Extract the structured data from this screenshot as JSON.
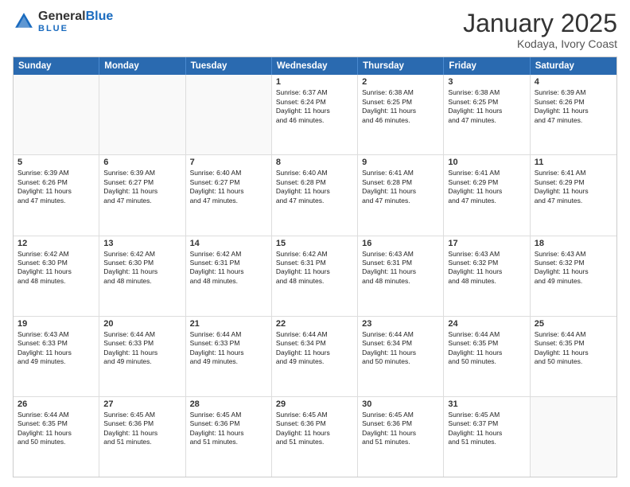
{
  "header": {
    "logo_general": "General",
    "logo_blue": "Blue",
    "month_title": "January 2025",
    "subtitle": "Kodaya, Ivory Coast"
  },
  "days_of_week": [
    "Sunday",
    "Monday",
    "Tuesday",
    "Wednesday",
    "Thursday",
    "Friday",
    "Saturday"
  ],
  "weeks": [
    [
      {
        "day": "",
        "text": "",
        "empty": true
      },
      {
        "day": "",
        "text": "",
        "empty": true
      },
      {
        "day": "",
        "text": "",
        "empty": true
      },
      {
        "day": "1",
        "text": "Sunrise: 6:37 AM\nSunset: 6:24 PM\nDaylight: 11 hours\nand 46 minutes.",
        "empty": false
      },
      {
        "day": "2",
        "text": "Sunrise: 6:38 AM\nSunset: 6:25 PM\nDaylight: 11 hours\nand 46 minutes.",
        "empty": false
      },
      {
        "day": "3",
        "text": "Sunrise: 6:38 AM\nSunset: 6:25 PM\nDaylight: 11 hours\nand 47 minutes.",
        "empty": false
      },
      {
        "day": "4",
        "text": "Sunrise: 6:39 AM\nSunset: 6:26 PM\nDaylight: 11 hours\nand 47 minutes.",
        "empty": false
      }
    ],
    [
      {
        "day": "5",
        "text": "Sunrise: 6:39 AM\nSunset: 6:26 PM\nDaylight: 11 hours\nand 47 minutes.",
        "empty": false
      },
      {
        "day": "6",
        "text": "Sunrise: 6:39 AM\nSunset: 6:27 PM\nDaylight: 11 hours\nand 47 minutes.",
        "empty": false
      },
      {
        "day": "7",
        "text": "Sunrise: 6:40 AM\nSunset: 6:27 PM\nDaylight: 11 hours\nand 47 minutes.",
        "empty": false
      },
      {
        "day": "8",
        "text": "Sunrise: 6:40 AM\nSunset: 6:28 PM\nDaylight: 11 hours\nand 47 minutes.",
        "empty": false
      },
      {
        "day": "9",
        "text": "Sunrise: 6:41 AM\nSunset: 6:28 PM\nDaylight: 11 hours\nand 47 minutes.",
        "empty": false
      },
      {
        "day": "10",
        "text": "Sunrise: 6:41 AM\nSunset: 6:29 PM\nDaylight: 11 hours\nand 47 minutes.",
        "empty": false
      },
      {
        "day": "11",
        "text": "Sunrise: 6:41 AM\nSunset: 6:29 PM\nDaylight: 11 hours\nand 47 minutes.",
        "empty": false
      }
    ],
    [
      {
        "day": "12",
        "text": "Sunrise: 6:42 AM\nSunset: 6:30 PM\nDaylight: 11 hours\nand 48 minutes.",
        "empty": false
      },
      {
        "day": "13",
        "text": "Sunrise: 6:42 AM\nSunset: 6:30 PM\nDaylight: 11 hours\nand 48 minutes.",
        "empty": false
      },
      {
        "day": "14",
        "text": "Sunrise: 6:42 AM\nSunset: 6:31 PM\nDaylight: 11 hours\nand 48 minutes.",
        "empty": false
      },
      {
        "day": "15",
        "text": "Sunrise: 6:42 AM\nSunset: 6:31 PM\nDaylight: 11 hours\nand 48 minutes.",
        "empty": false
      },
      {
        "day": "16",
        "text": "Sunrise: 6:43 AM\nSunset: 6:31 PM\nDaylight: 11 hours\nand 48 minutes.",
        "empty": false
      },
      {
        "day": "17",
        "text": "Sunrise: 6:43 AM\nSunset: 6:32 PM\nDaylight: 11 hours\nand 48 minutes.",
        "empty": false
      },
      {
        "day": "18",
        "text": "Sunrise: 6:43 AM\nSunset: 6:32 PM\nDaylight: 11 hours\nand 49 minutes.",
        "empty": false
      }
    ],
    [
      {
        "day": "19",
        "text": "Sunrise: 6:43 AM\nSunset: 6:33 PM\nDaylight: 11 hours\nand 49 minutes.",
        "empty": false
      },
      {
        "day": "20",
        "text": "Sunrise: 6:44 AM\nSunset: 6:33 PM\nDaylight: 11 hours\nand 49 minutes.",
        "empty": false
      },
      {
        "day": "21",
        "text": "Sunrise: 6:44 AM\nSunset: 6:33 PM\nDaylight: 11 hours\nand 49 minutes.",
        "empty": false
      },
      {
        "day": "22",
        "text": "Sunrise: 6:44 AM\nSunset: 6:34 PM\nDaylight: 11 hours\nand 49 minutes.",
        "empty": false
      },
      {
        "day": "23",
        "text": "Sunrise: 6:44 AM\nSunset: 6:34 PM\nDaylight: 11 hours\nand 50 minutes.",
        "empty": false
      },
      {
        "day": "24",
        "text": "Sunrise: 6:44 AM\nSunset: 6:35 PM\nDaylight: 11 hours\nand 50 minutes.",
        "empty": false
      },
      {
        "day": "25",
        "text": "Sunrise: 6:44 AM\nSunset: 6:35 PM\nDaylight: 11 hours\nand 50 minutes.",
        "empty": false
      }
    ],
    [
      {
        "day": "26",
        "text": "Sunrise: 6:44 AM\nSunset: 6:35 PM\nDaylight: 11 hours\nand 50 minutes.",
        "empty": false
      },
      {
        "day": "27",
        "text": "Sunrise: 6:45 AM\nSunset: 6:36 PM\nDaylight: 11 hours\nand 51 minutes.",
        "empty": false
      },
      {
        "day": "28",
        "text": "Sunrise: 6:45 AM\nSunset: 6:36 PM\nDaylight: 11 hours\nand 51 minutes.",
        "empty": false
      },
      {
        "day": "29",
        "text": "Sunrise: 6:45 AM\nSunset: 6:36 PM\nDaylight: 11 hours\nand 51 minutes.",
        "empty": false
      },
      {
        "day": "30",
        "text": "Sunrise: 6:45 AM\nSunset: 6:36 PM\nDaylight: 11 hours\nand 51 minutes.",
        "empty": false
      },
      {
        "day": "31",
        "text": "Sunrise: 6:45 AM\nSunset: 6:37 PM\nDaylight: 11 hours\nand 51 minutes.",
        "empty": false
      },
      {
        "day": "",
        "text": "",
        "empty": true
      }
    ]
  ]
}
